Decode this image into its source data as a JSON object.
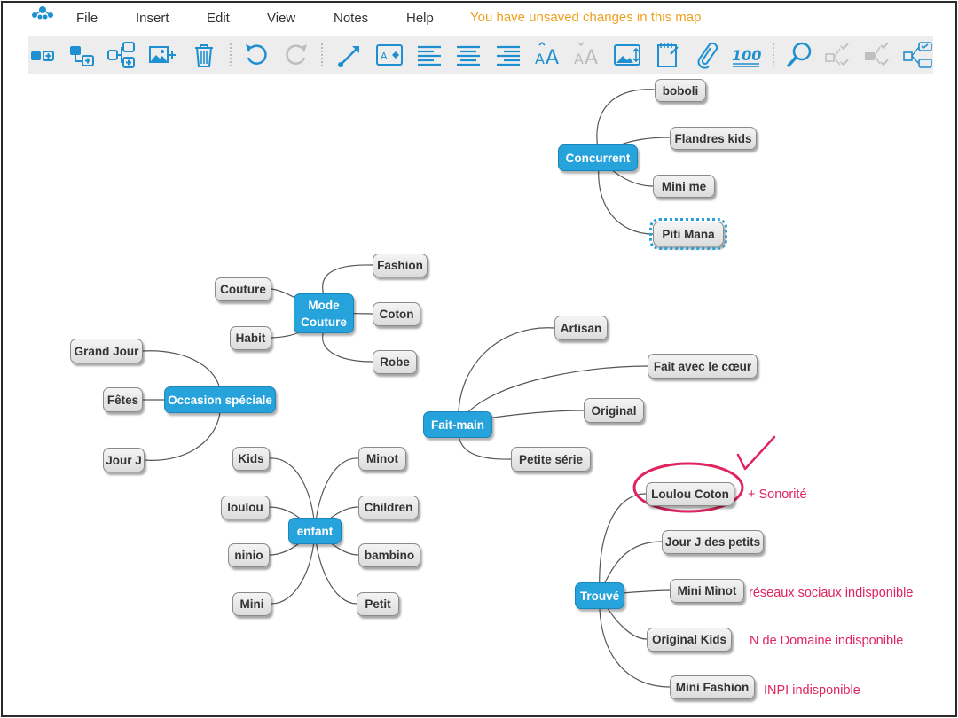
{
  "menu": {
    "file": "File",
    "insert": "Insert",
    "edit": "Edit",
    "view": "View",
    "notes": "Notes",
    "help": "Help"
  },
  "status": {
    "unsaved": "You have unsaved changes in this map"
  },
  "toolbar": {
    "icons": [
      "add-node-icon",
      "add-child-icon",
      "add-sibling-icon",
      "add-image-icon",
      "delete-icon",
      "undo-icon",
      "redo-icon",
      "connector-icon",
      "node-style-icon",
      "align-left-icon",
      "align-center-icon",
      "align-right-icon",
      "font-larger-icon",
      "font-smaller-icon",
      "image-fit-icon",
      "note-icon",
      "link-icon",
      "rating-100-icon",
      "search-icon",
      "task-icon",
      "task-tree-icon",
      "task-list-icon"
    ],
    "accent": "#1e8fd0"
  },
  "mindmap": {
    "hub_color": "#27a3dc",
    "hubs": {
      "concurrent": "Concurrent",
      "mode_couture_line1": "Mode",
      "mode_couture_line2": "Couture",
      "occasion": "Occasion spéciale",
      "fait_main": "Fait-main",
      "enfant": "enfant",
      "trouve": "Trouvé"
    },
    "concurrent_children": [
      "boboli",
      "Flandres kids",
      "Mini me",
      "Piti Mana"
    ],
    "mode_children": [
      "Fashion",
      "Coton",
      "Robe",
      "Couture",
      "Habit"
    ],
    "occasion_children": [
      "Grand Jour",
      "Fêtes",
      "Jour J"
    ],
    "fait_main_children": [
      "Artisan",
      "Fait avec le cœur",
      "Original",
      "Petite série"
    ],
    "enfant_children": [
      "Kids",
      "loulou",
      "ninio",
      "Mini",
      "Minot",
      "Children",
      "bambino",
      "Petit"
    ],
    "trouve_children": [
      "Loulou Coton",
      "Jour J des petits",
      "Mini Minot",
      "Original Kids",
      "Mini Fashion"
    ],
    "selected_node": "Piti Mana"
  },
  "annotations": {
    "sonorite": "+ Sonorité",
    "reseaux": "réseaux sociaux indisponible",
    "domaine": "N de Domaine indisponible",
    "inpi": "INPI indisponible",
    "color": "#e0245e"
  }
}
